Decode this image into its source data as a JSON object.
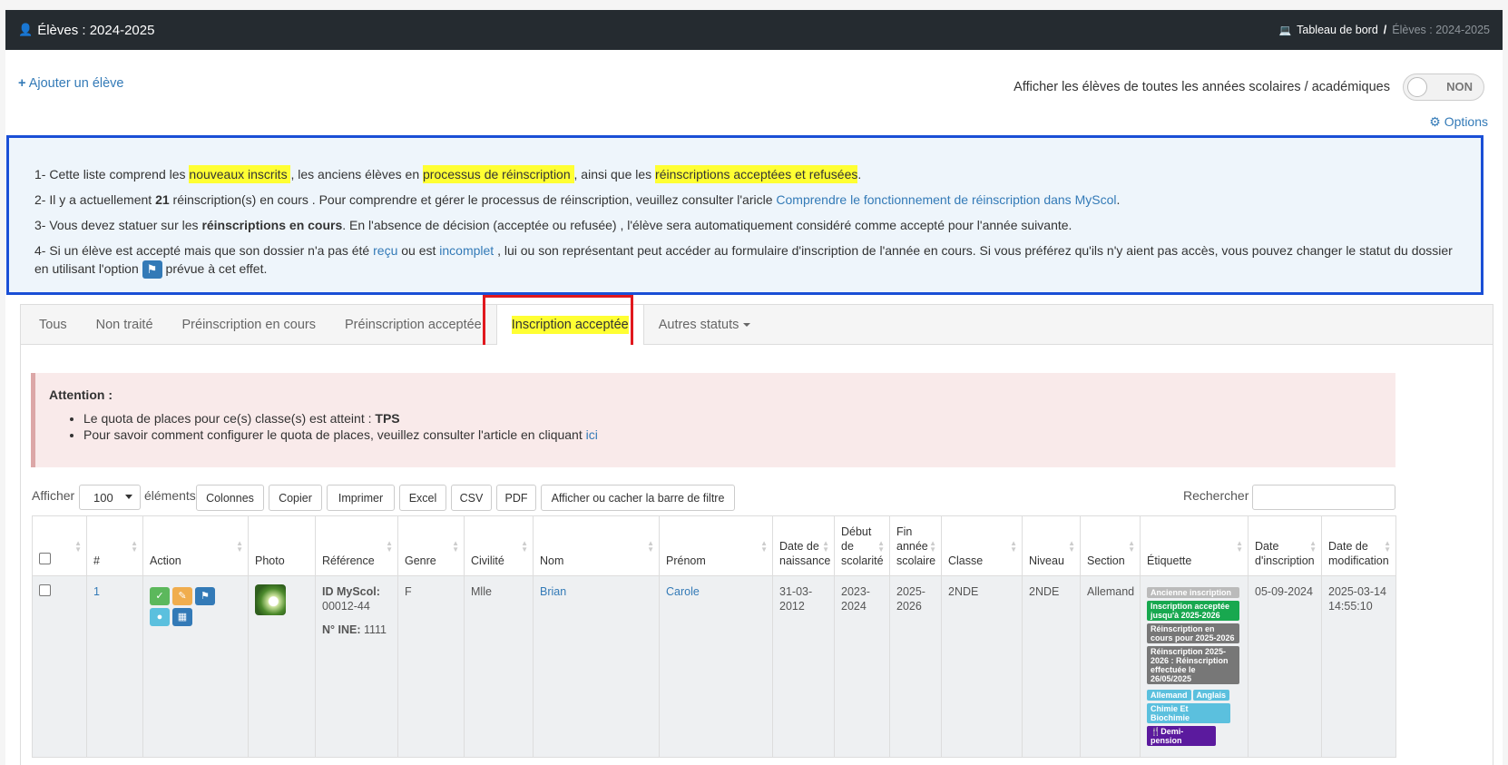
{
  "header": {
    "title": "Élèves : 2024-2025",
    "breadcrumb_home": "Tableau de bord",
    "breadcrumb_sep": "/",
    "breadcrumb_current": "Élèves : 2024-2025"
  },
  "actions": {
    "add_student": "Ajouter un élève",
    "show_all_years_label": "Afficher les élèves de toutes les années scolaires / académiques",
    "toggle_value": "NON",
    "options": "Options"
  },
  "info": {
    "l1_a": "1- Cette liste comprend les ",
    "l1_b": "nouveaux inscrits ",
    "l1_c": ", les anciens élèves en ",
    "l1_d": "processus de réinscription ",
    "l1_e": ", ainsi que les ",
    "l1_f": "réinscriptions acceptées",
    "l1_g": " et ",
    "l1_h": "refusées",
    "l1_i": ".",
    "l2_a": "2- Il y a actuellement ",
    "l2_b": "21",
    "l2_c": " réinscription(s) en cours . Pour comprendre et gérer le processus de réinscription, veuillez consulter l'aricle ",
    "l2_link": "Comprendre le fonctionnement de réinscription dans MyScol",
    "l2_d": ".",
    "l3_a": "3- Vous devez statuer sur les ",
    "l3_b": "réinscriptions en cours",
    "l3_c": ". En l'absence de décision (acceptée ou refusée) , l'élève sera automatiquement considéré comme accepté pour l'année suivante.",
    "l4_a": "4- Si un élève est accepté mais que son dossier n'a pas été ",
    "l4_recu": "reçu",
    "l4_b": " ou est ",
    "l4_incomplet": "incomplet",
    "l4_c": " , lui ou son représentant peut accéder au formulaire d'inscription de l'année en cours. Si vous préférez qu'ils n'y aient pas accès, vous pouvez changer le statut du dossier en utilisant l'option ",
    "l4_d": " prévue à cet effet."
  },
  "tabs": [
    {
      "label": "Tous"
    },
    {
      "label": "Non traité"
    },
    {
      "label": "Préinscription en cours"
    },
    {
      "label": "Préinscription acceptée"
    },
    {
      "label": "Inscription acceptée"
    },
    {
      "label": "Autres statuts"
    }
  ],
  "alert": {
    "title": "Attention :",
    "item1_a": "Le quota de places pour ce(s) classe(s) est atteint : ",
    "item1_b": "TPS",
    "item2_a": "Pour savoir comment configurer le quota de places, veuillez consulter l'article en cliquant ",
    "item2_link": "ici"
  },
  "toolbar": {
    "show": "Afficher",
    "page_size": "100",
    "elements": "éléments",
    "buttons": [
      "Colonnes",
      "Copier",
      "Imprimer",
      "Excel",
      "CSV",
      "PDF",
      "Afficher ou cacher la barre de filtre"
    ],
    "search_label": "Rechercher :"
  },
  "table": {
    "headers": [
      "#",
      "Action",
      "Photo",
      "Référence",
      "Genre",
      "Civilité",
      "Nom",
      "Prénom",
      "Date de naissance",
      "Début de scolarité",
      "Fin année scolaire",
      "Classe",
      "Niveau",
      "Section",
      "Étiquette",
      "Date d'inscription",
      "Date de modification"
    ],
    "row": {
      "num": "1",
      "ref_id_label": "ID MyScol:",
      "ref_id_value": "00012-44",
      "ref_ine_label": "N° INE:",
      "ref_ine_value": "1111",
      "genre": "F",
      "civilite": "Mlle",
      "nom": "Brian",
      "prenom": "Carole",
      "naissance": "31-03-2012",
      "debut": "2023-2024",
      "fin": "2025-2026",
      "classe": "2NDE",
      "niveau": "2NDE",
      "section": "Allemand",
      "labels": {
        "l1": "Ancienne inscription",
        "l2": "Inscription acceptée jusqu'à 2025-2026",
        "l3": "Réinscription en cours pour 2025-2026",
        "l4": "Réinscription 2025-2026 : Réinscription effectuée le 26/05/2025",
        "l5": "Allemand",
        "l6": "Anglais",
        "l7": "Chimie Et Biochimie",
        "l8": "Demi-pension"
      },
      "date_inscription": "05-09-2024",
      "date_modification": "2025-03-14 14:55:10"
    }
  },
  "colors": {
    "header_bg": "#252b30",
    "link": "#337ab7",
    "highlight": "#ffff33",
    "info_border": "#1a4fd6",
    "tab_box": "#e0181e",
    "label_green": "#18a84f",
    "label_gray": "#777777",
    "label_cyan": "#5bc0de",
    "label_purple": "#5b1a9e"
  }
}
